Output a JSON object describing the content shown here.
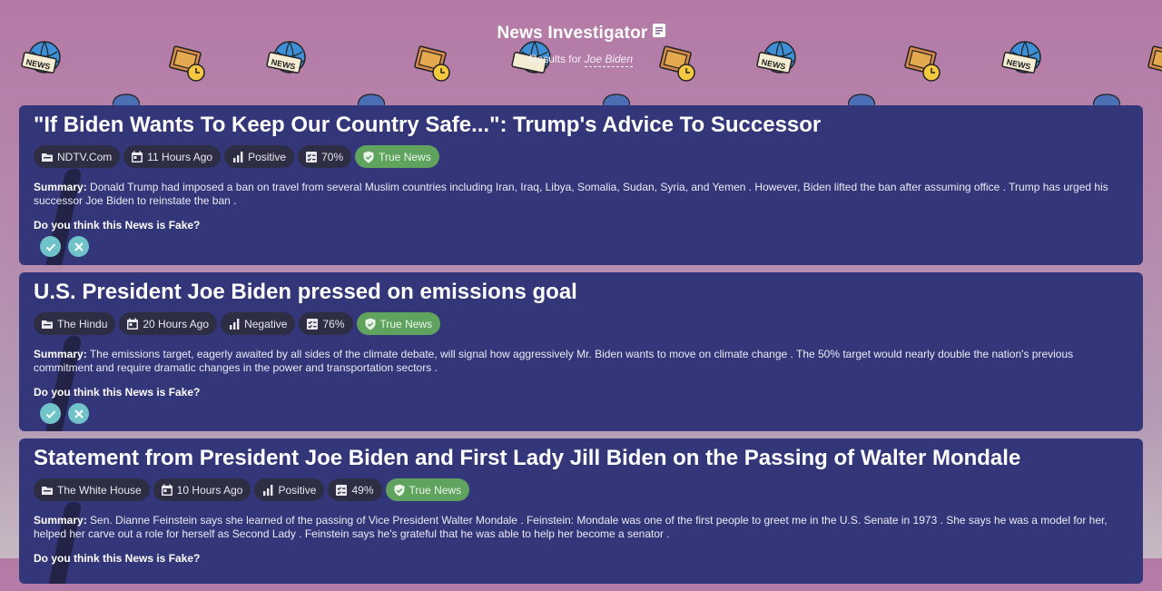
{
  "header": {
    "app_title": "News Investigator",
    "results_prefix": "Results for",
    "query": "Joe Biden"
  },
  "colors": {
    "card_bg": "#333779",
    "chip_bg": "#2d2d44",
    "true_news": "#5fa35f",
    "vote_button": "#6fc3c9"
  },
  "vote_question": "Do you think this News is Fake?",
  "summary_label": "Summary:",
  "articles": [
    {
      "title": "\"If Biden Wants To Keep Our Country Safe...\": Trump's Advice To Successor",
      "source": "NDTV.Com",
      "time": "11 Hours Ago",
      "sentiment": "Positive",
      "score": "70%",
      "verdict": "True News",
      "summary": "Donald Trump had imposed a ban on travel from several Muslim countries including Iran, Iraq, Libya, Somalia, Sudan, Syria, and Yemen . However, Biden lifted the ban after assuming office . Trump has urged his successor Joe Biden to reinstate the ban ."
    },
    {
      "title": "U.S. President Joe Biden pressed on emissions goal",
      "source": "The Hindu",
      "time": "20 Hours Ago",
      "sentiment": "Negative",
      "score": "76%",
      "verdict": "True News",
      "summary": "The emissions target, eagerly awaited by all sides of the climate debate, will signal how aggressively Mr. Biden wants to move on climate change . The 50% target would nearly double the nation's previous commitment and require dramatic changes in the power and transportation sectors ."
    },
    {
      "title": "Statement from President Joe Biden and First Lady Jill Biden on the Passing of Walter Mondale",
      "source": "The White House",
      "time": "10 Hours Ago",
      "sentiment": "Positive",
      "score": "49%",
      "verdict": "True News",
      "summary": "Sen. Dianne Feinstein says she learned of the passing of Vice President Walter Mondale . Feinstein: Mondale was one of the first people to greet me in the U.S. Senate in 1973 . She says he was a model for her, helped her carve out a role for herself as Second Lady . Feinstein says he's grateful that he was able to help her become a senator ."
    }
  ]
}
